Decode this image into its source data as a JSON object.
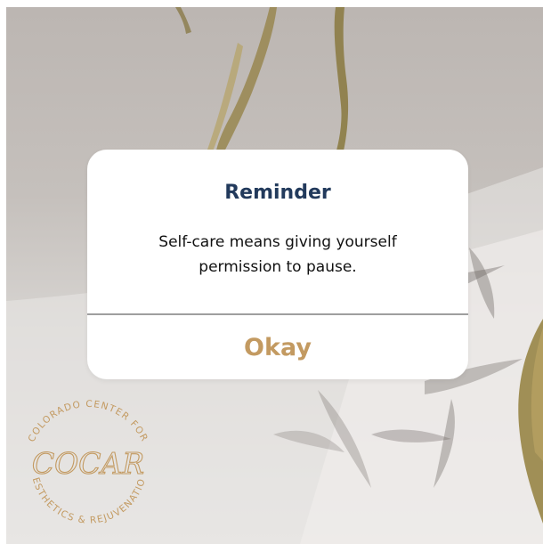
{
  "dialog": {
    "title": "Reminder",
    "message": "Self-care means giving yourself permission to pause.",
    "button_label": "Okay"
  },
  "logo": {
    "top_text": "COLORADO CENTER FOR",
    "bottom_text": "AESTHETICS & REJUVENATION",
    "script": "COCAR"
  },
  "colors": {
    "title": "#223a5c",
    "accent": "#c39a61",
    "text": "#111111",
    "divider": "#9e9e9e"
  }
}
